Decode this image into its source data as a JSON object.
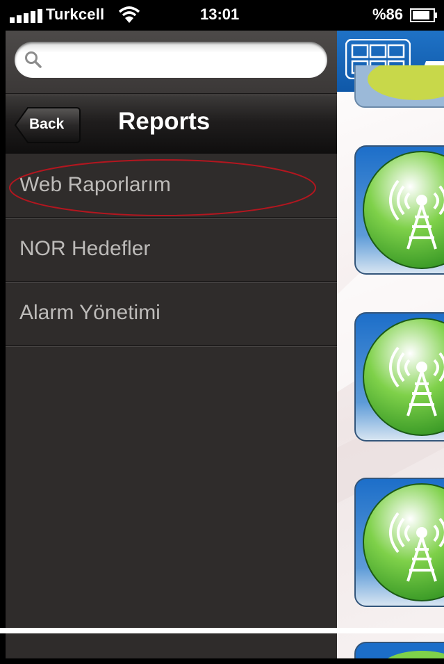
{
  "status_bar": {
    "carrier": "Turkcell",
    "time": "13:01",
    "battery_text": "%86"
  },
  "menu": {
    "search": {
      "placeholder": "",
      "value": ""
    },
    "nav": {
      "back_label": "Back",
      "title": "Reports"
    },
    "items": [
      {
        "label": "Web Raporlarım"
      },
      {
        "label": "NOR Hedefler"
      },
      {
        "label": "Alarm Yönetimi"
      }
    ],
    "highlight_color": "#b3161f"
  },
  "content": {
    "accent": "#1565c0",
    "tiles": [
      {
        "icon": "signal-tower-icon"
      },
      {
        "icon": "signal-tower-icon"
      },
      {
        "icon": "signal-tower-icon"
      },
      {
        "icon": "signal-tower-icon"
      }
    ]
  }
}
